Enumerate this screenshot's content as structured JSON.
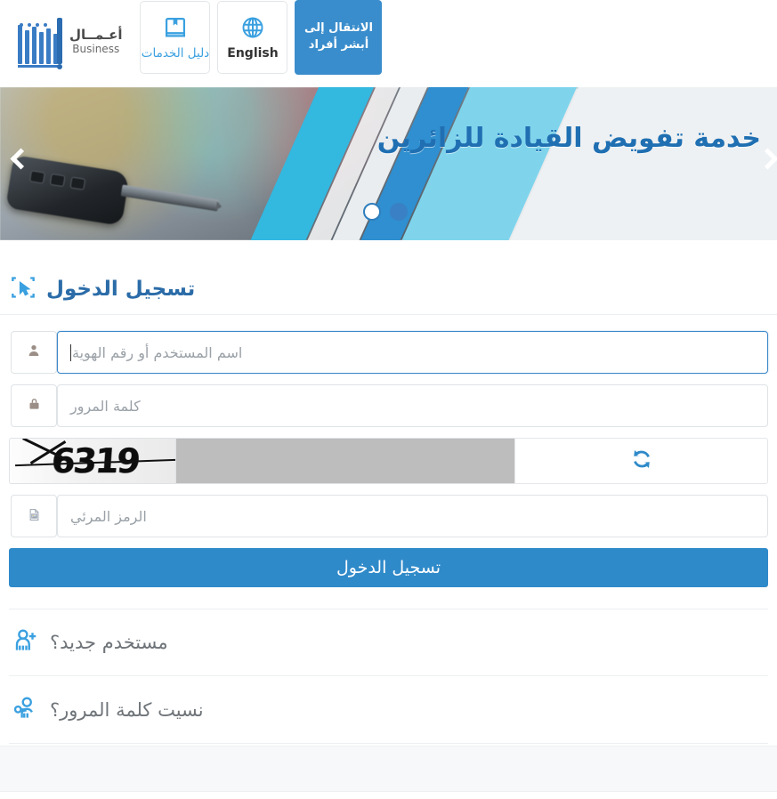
{
  "header": {
    "logo": {
      "arabic": "أعـمــال",
      "english": "Business",
      "icon": "absher-logo-icon"
    },
    "services_guide": {
      "label": "دليل الخدمات",
      "icon": "book-icon"
    },
    "language": {
      "label": "English",
      "icon": "globe-icon"
    },
    "cta": {
      "label": "الانتقال إلى أبشر أفراد"
    }
  },
  "banner": {
    "title": "خدمة تفويض القيادة للزائرين",
    "prev_icon": "chevron-left-icon",
    "next_icon": "chevron-right-icon",
    "dots": [
      {
        "state": "active"
      },
      {
        "state": "inactive"
      }
    ]
  },
  "login": {
    "heading": "تسجيل الدخول",
    "heading_icon": "cursor-select-icon",
    "username": {
      "placeholder": "اسم المستخدم أو رقم الهوية",
      "value": "",
      "icon": "user-icon",
      "focused": true
    },
    "password": {
      "placeholder": "كلمة المرور",
      "value": "",
      "icon": "lock-icon",
      "focused": false
    },
    "captcha": {
      "code": "6319",
      "refresh_icon": "refresh-icon",
      "input_placeholder": "الرمز المرئي",
      "input_value": "",
      "input_icon": "image-icon"
    },
    "submit_label": "تسجيل الدخول",
    "new_user": {
      "label": "مستخدم جديد؟",
      "icon": "user-plus-icon"
    },
    "forgot_password": {
      "label": "نسيت كلمة المرور؟",
      "icon": "user-key-icon"
    }
  },
  "colors": {
    "primary_blue": "#2f8ac9",
    "logo_blue": "#3a7cc4",
    "banner_text": "#1f6fb2",
    "icon_blue": "#3aa0e0",
    "cyan": "#33b8e0"
  }
}
